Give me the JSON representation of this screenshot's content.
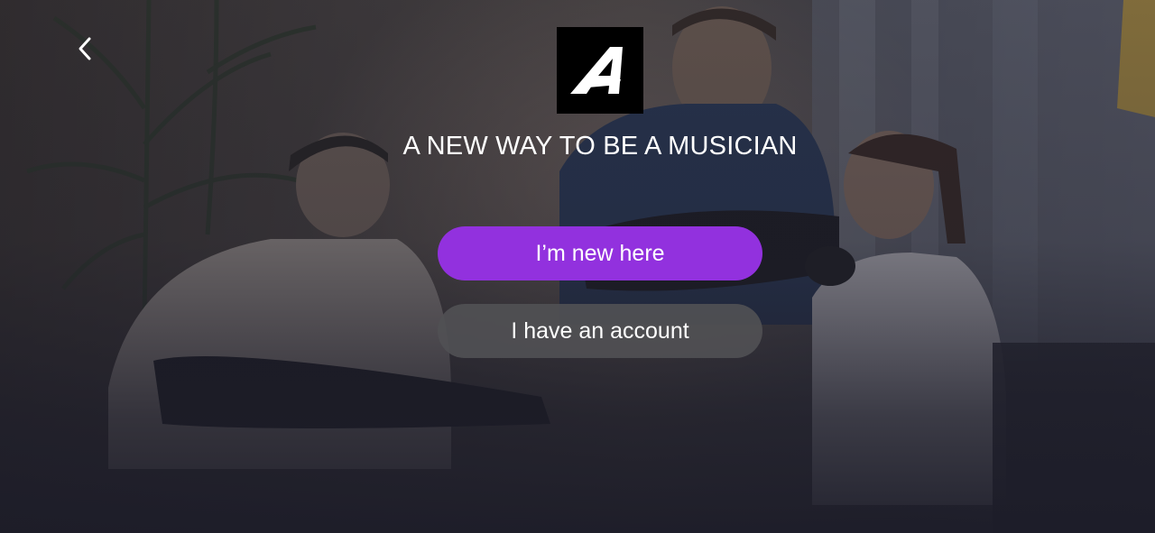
{
  "header": {
    "back_icon": "chevron-left-icon",
    "logo_icon": "brand-a-logo"
  },
  "hero": {
    "tagline": "A NEW WAY TO BE A MUSICIAN"
  },
  "actions": {
    "new_user_label": "I’m new here",
    "existing_account_label": "I have an account"
  },
  "colors": {
    "primary_button": "#9231de",
    "secondary_button": "#505054",
    "logo_background": "#000000",
    "text": "#ffffff"
  }
}
